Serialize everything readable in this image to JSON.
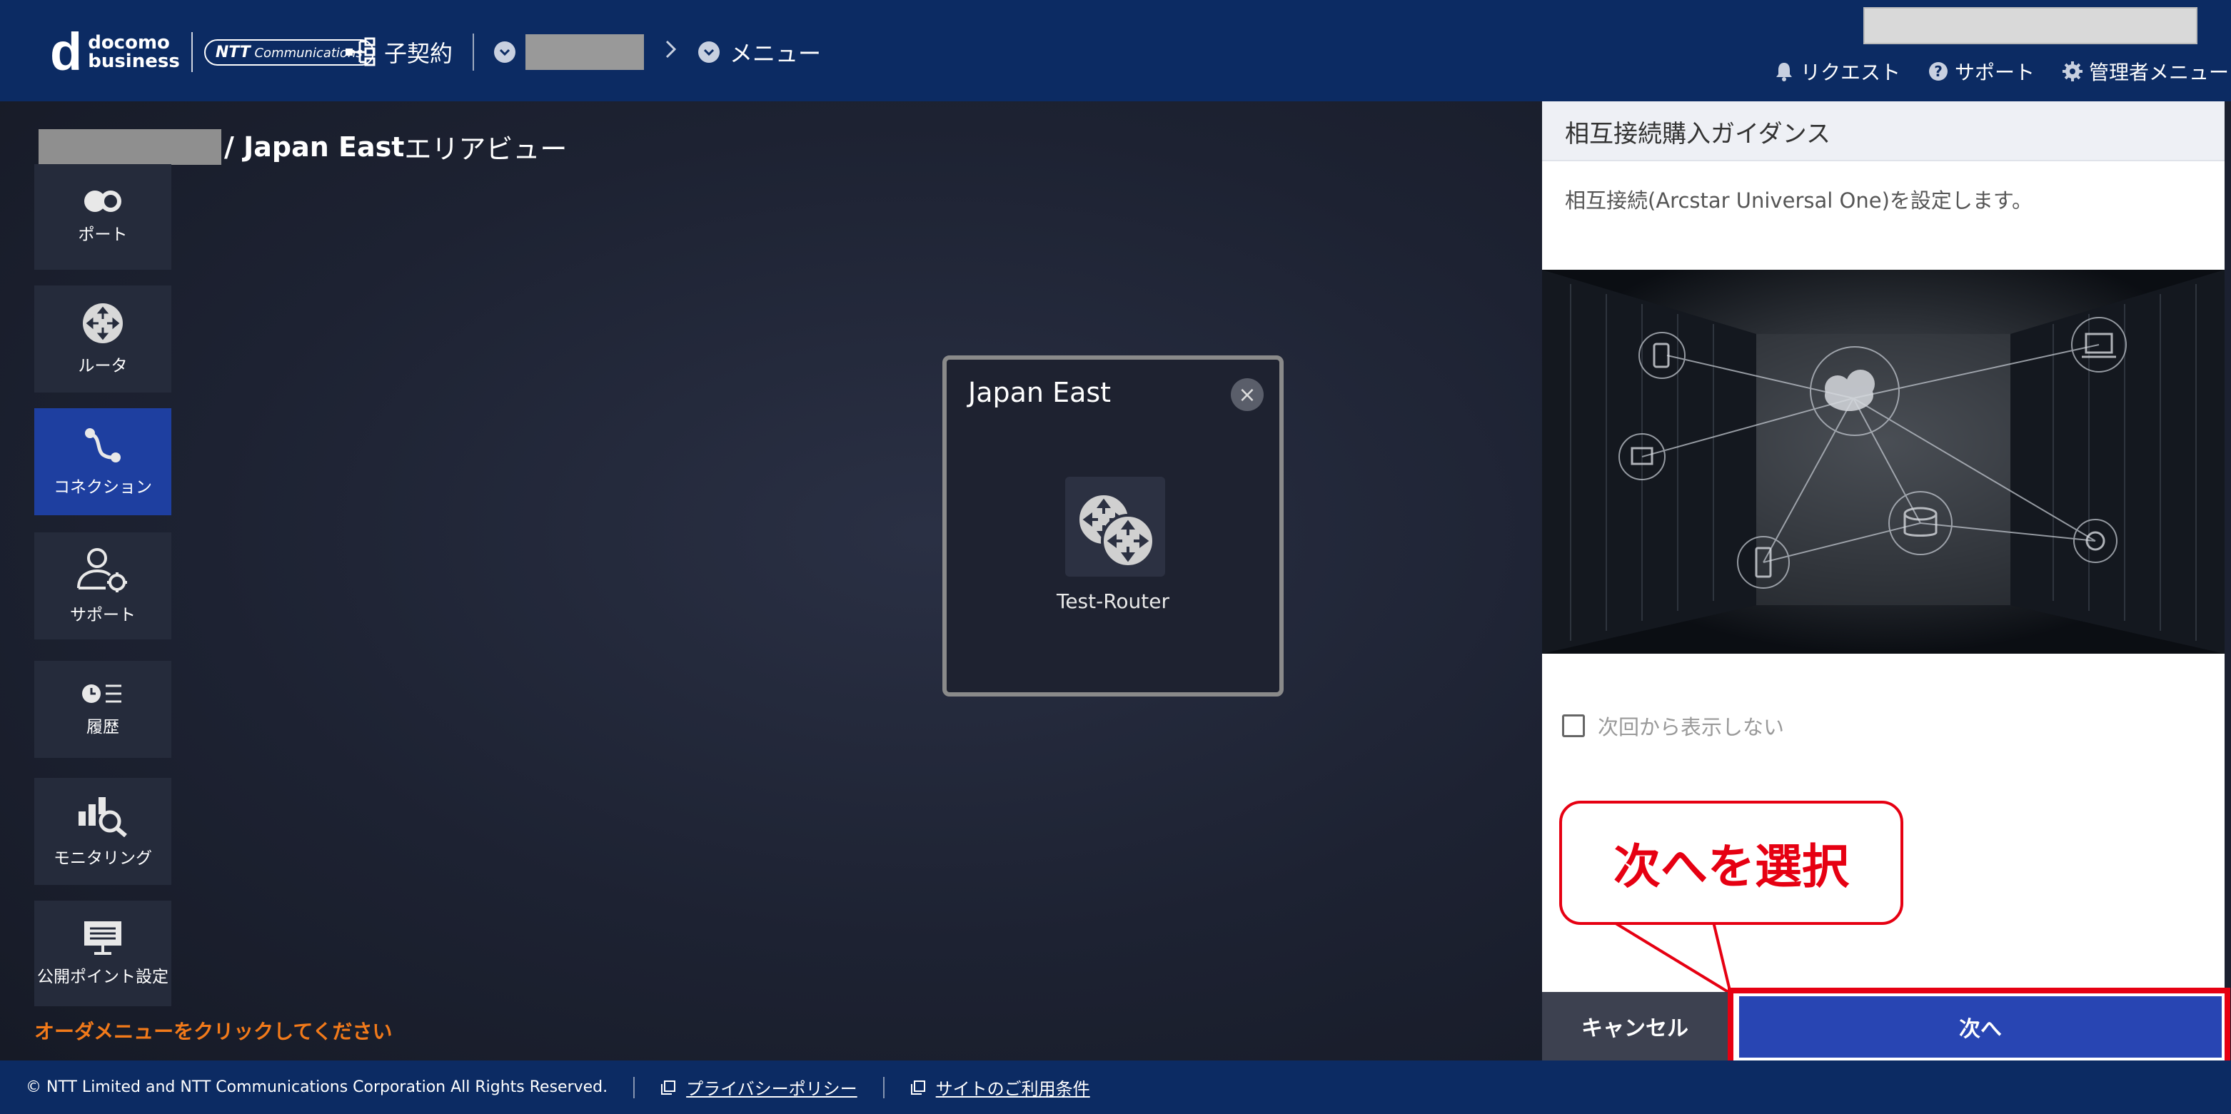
{
  "header": {
    "logo": {
      "line1": "docomo",
      "line2": "business",
      "ntt_badge_bold": "NTT",
      "ntt_badge_rest": "Communications"
    },
    "breadcrumb": {
      "contract_label": "子契約",
      "menu_label": "メニュー"
    },
    "nav": {
      "request": "リクエスト",
      "support": "サポート",
      "admin_menu": "管理者メニュー"
    }
  },
  "area": {
    "title_region": "/ Japan East",
    "title_suffix": " エリアビュー"
  },
  "sidebar": {
    "items": [
      {
        "label": "ポート",
        "icon": "port-icon"
      },
      {
        "label": "ルータ",
        "icon": "router-icon"
      },
      {
        "label": "コネクション",
        "icon": "connection-icon",
        "active": true
      },
      {
        "label": "サポート",
        "icon": "support-user-icon"
      },
      {
        "label": "履歴",
        "icon": "history-icon"
      },
      {
        "label": "モニタリング",
        "icon": "monitoring-icon"
      },
      {
        "label": "公開ポイント設定",
        "icon": "public-point-icon"
      }
    ],
    "order_hint": "オーダメニューをクリックしてください"
  },
  "popup": {
    "title": "Japan East",
    "router_name": "Test-Router",
    "close_symbol": "×"
  },
  "panel": {
    "title": "相互接続購入ガイダンス",
    "description": "相互接続(Arcstar Universal One)を設定します。",
    "checkbox_label": "次回から表示しない",
    "cancel_label": "キャンセル",
    "next_label": "次へ"
  },
  "callout": {
    "text": "次へを選択"
  },
  "footer": {
    "copyright": "© NTT Limited and NTT Communications Corporation All Rights Reserved.",
    "privacy": "プライバシーポリシー",
    "terms": "サイトのご利用条件"
  },
  "colors": {
    "header_bg": "#0c2b63",
    "active_sidebar": "#1e3fa0",
    "primary_button": "#2845b3",
    "highlight_red": "#e60012",
    "hint_orange": "#f27a1a"
  }
}
